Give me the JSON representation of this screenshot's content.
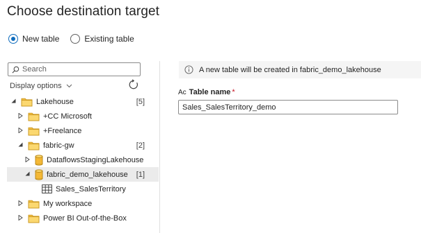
{
  "dialog": {
    "title": "Choose destination target"
  },
  "target_mode": {
    "options": [
      {
        "label": "New table",
        "checked": true
      },
      {
        "label": "Existing table",
        "checked": false
      }
    ]
  },
  "navigator": {
    "search_placeholder": "Search",
    "display_options_label": "Display options",
    "tree": [
      {
        "label": "Lakehouse",
        "count": "[5]",
        "icon": "folder-icon",
        "level": 0,
        "expanded": true
      },
      {
        "label": "+CC Microsoft",
        "count": "",
        "icon": "folder-icon",
        "level": 1,
        "expanded": false
      },
      {
        "label": "+Freelance",
        "count": "",
        "icon": "folder-icon",
        "level": 1,
        "expanded": false
      },
      {
        "label": "fabric-gw",
        "count": "[2]",
        "icon": "folder-icon",
        "level": 1,
        "expanded": true
      },
      {
        "label": "DataflowsStagingLakehouse",
        "count": "",
        "icon": "database-icon",
        "level": 2,
        "expanded": false
      },
      {
        "label": "fabric_demo_lakehouse",
        "count": "[1]",
        "icon": "database-icon",
        "level": 2,
        "expanded": true,
        "selected": true
      },
      {
        "label": "Sales_SalesTerritory",
        "count": "",
        "icon": "table-icon",
        "level": 3
      },
      {
        "label": "My workspace",
        "count": "",
        "icon": "folder-icon",
        "level": 1,
        "expanded": false
      },
      {
        "label": "Power BI Out-of-the-Box",
        "count": "",
        "icon": "folder-icon",
        "level": 1,
        "expanded": false
      }
    ]
  },
  "details": {
    "info_message": "A new table will be created in fabric_demo_lakehouse",
    "table_name_label": "Table name",
    "required_marker": "*",
    "table_name_value": "Sales_SalesTerritory_demo"
  },
  "colors": {
    "accent": "#0f6cbd",
    "folder": "#f5c144",
    "database": "#f4b836"
  }
}
